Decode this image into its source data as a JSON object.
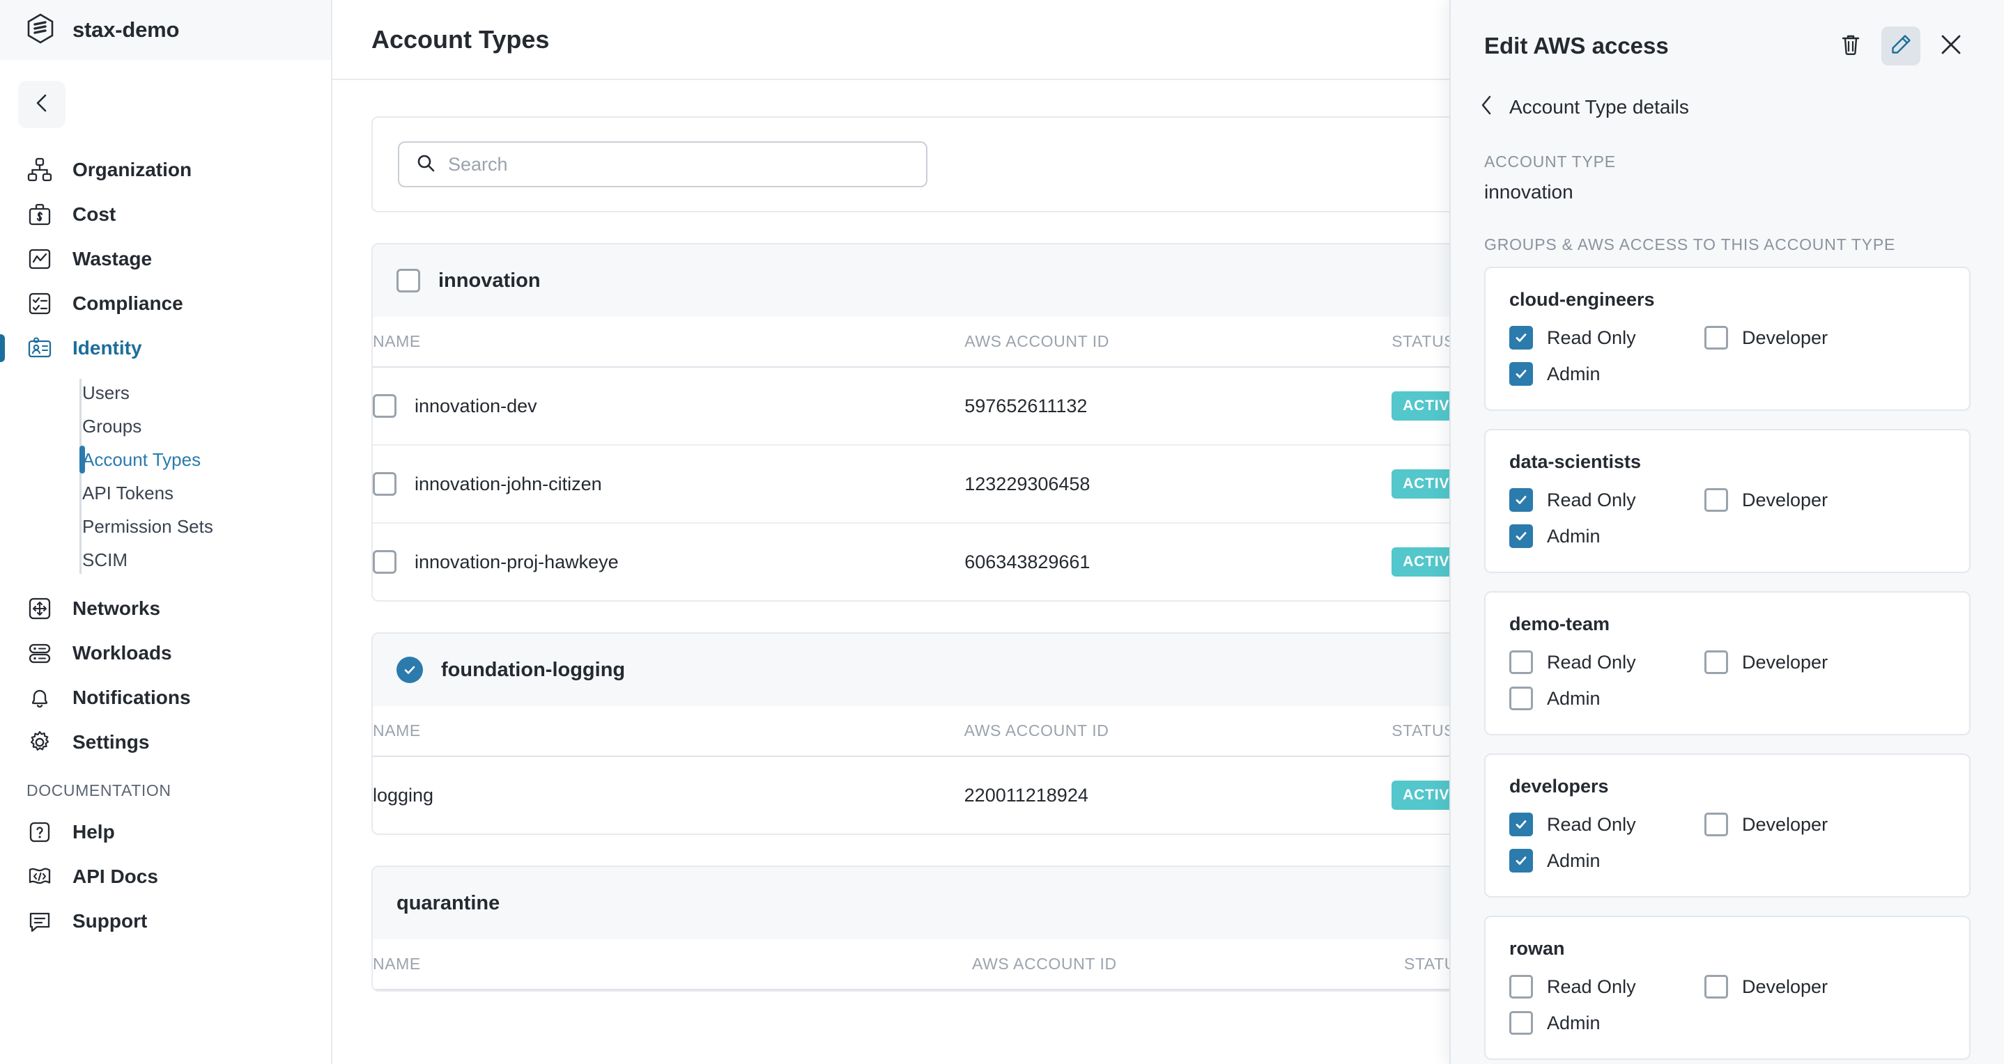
{
  "brand": {
    "name": "stax-demo",
    "logo_icon": "stax-hexagon-logo-icon"
  },
  "sidebar": {
    "collapse_icon": "chevron-left-icon",
    "items": [
      {
        "label": "Organization",
        "icon": "org-chart-icon",
        "active": false
      },
      {
        "label": "Cost",
        "icon": "briefcase-dollar-icon",
        "active": false
      },
      {
        "label": "Wastage",
        "icon": "chart-line-icon",
        "active": false
      },
      {
        "label": "Compliance",
        "icon": "checklist-icon",
        "active": false
      },
      {
        "label": "Identity",
        "icon": "id-card-icon",
        "active": true
      }
    ],
    "identity_subitems": [
      {
        "label": "Users",
        "active": false
      },
      {
        "label": "Groups",
        "active": false
      },
      {
        "label": "Account Types",
        "active": true
      },
      {
        "label": "API Tokens",
        "active": false
      },
      {
        "label": "Permission Sets",
        "active": false
      },
      {
        "label": "SCIM",
        "active": false
      }
    ],
    "items_after": [
      {
        "label": "Networks",
        "icon": "move-arrows-icon"
      },
      {
        "label": "Workloads",
        "icon": "servers-icon"
      },
      {
        "label": "Notifications",
        "icon": "bell-icon"
      },
      {
        "label": "Settings",
        "icon": "gear-icon"
      }
    ],
    "documentation_label": "DOCUMENTATION",
    "documentation_items": [
      {
        "label": "Help",
        "icon": "question-box-icon"
      },
      {
        "label": "API Docs",
        "icon": "code-flag-icon"
      }
    ],
    "support": {
      "label": "Support",
      "icon": "chat-bubble-icon"
    }
  },
  "main": {
    "page_title": "Account Types",
    "search": {
      "placeholder": "Search",
      "value": "",
      "icon": "search-icon"
    },
    "columns": {
      "name": "NAME",
      "aws_account_id": "AWS ACCOUNT ID",
      "status": "STATUS"
    },
    "groups": [
      {
        "name": "innovation",
        "checked": false,
        "rows": [
          {
            "name": "innovation-dev",
            "aws_account_id": "597652611132",
            "status": "ACTIVE",
            "checkbox": true,
            "checked": false
          },
          {
            "name": "innovation-john-citizen",
            "aws_account_id": "123229306458",
            "status": "ACTIVE",
            "checkbox": true,
            "checked": false
          },
          {
            "name": "innovation-proj-hawkeye",
            "aws_account_id": "606343829661",
            "status": "ACTIVE",
            "checkbox": true,
            "checked": false
          }
        ]
      },
      {
        "name": "foundation-logging",
        "checked": true,
        "rows": [
          {
            "name": "logging",
            "aws_account_id": "220011218924",
            "status": "ACTIVE",
            "checkbox": false,
            "checked": false
          }
        ]
      },
      {
        "name": "quarantine",
        "checked": false,
        "rows": []
      }
    ]
  },
  "panel": {
    "title": "Edit AWS access",
    "delete_icon": "trash-icon",
    "edit_icon": "pencil-icon",
    "close_icon": "close-x-icon",
    "back_icon": "chevron-left-icon",
    "back_label": "Account Type details",
    "account_type_label": "ACCOUNT TYPE",
    "account_type_value": "innovation",
    "groups_section_label": "GROUPS & AWS ACCESS TO THIS ACCOUNT TYPE",
    "permission_labels": {
      "read_only": "Read Only",
      "developer": "Developer",
      "admin": "Admin"
    },
    "groups": [
      {
        "name": "cloud-engineers",
        "read_only": true,
        "developer": false,
        "admin": true
      },
      {
        "name": "data-scientists",
        "read_only": true,
        "developer": false,
        "admin": true
      },
      {
        "name": "demo-team",
        "read_only": false,
        "developer": false,
        "admin": false
      },
      {
        "name": "developers",
        "read_only": true,
        "developer": false,
        "admin": true
      },
      {
        "name": "rowan",
        "read_only": false,
        "developer": false,
        "admin": false
      }
    ]
  },
  "colors": {
    "accent_blue": "#2b7bad",
    "active_badge_teal": "#53c7cb",
    "sidebar_border": "#e7eaee",
    "panel_bg": "#f6f8fa",
    "text_dark": "#252a31",
    "text_muted": "#9aa3ad"
  }
}
